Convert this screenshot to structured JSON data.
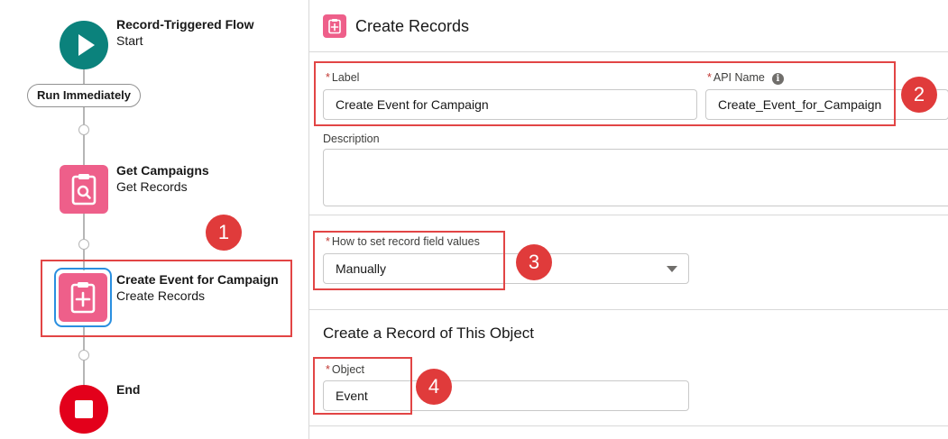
{
  "flow": {
    "start": {
      "title": "Record-Triggered Flow",
      "subtitle": "Start",
      "color": "#0b827c",
      "icon": "play-icon"
    },
    "run_label": "Run Immediately",
    "get_campaigns": {
      "title": "Get Campaigns",
      "subtitle": "Get Records",
      "color": "#ee5f8a",
      "icon": "get-records-icon"
    },
    "create_event": {
      "title": "Create Event for Campaign",
      "subtitle": "Create Records",
      "color": "#ee5f8a",
      "icon": "create-records-icon"
    },
    "end": {
      "title": "End",
      "color": "#e3001b",
      "icon": "stop-icon"
    }
  },
  "panel": {
    "title": "Create Records",
    "icon": "create-records-icon",
    "label_field": {
      "label": "Label",
      "value": "Create Event for Campaign"
    },
    "api_name_field": {
      "label": "API Name",
      "value": "Create_Event_for_Campaign"
    },
    "description_field": {
      "label": "Description",
      "value": ""
    },
    "field_values": {
      "label": "How to set record field values",
      "selected": "Manually"
    },
    "object_section": {
      "title": "Create a Record of This Object"
    },
    "object_field": {
      "label": "Object",
      "value": "Event"
    }
  },
  "annotations": {
    "badge_1": "1",
    "badge_2": "2",
    "badge_3": "3",
    "badge_4": "4",
    "highlight_color": "#e24545"
  }
}
